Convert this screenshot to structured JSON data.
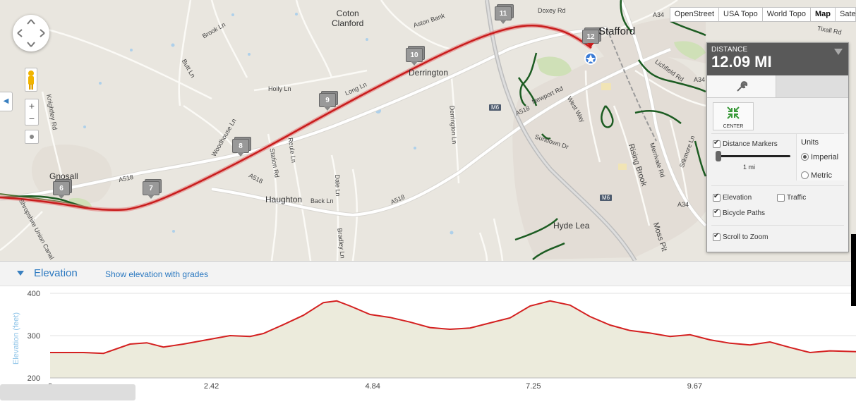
{
  "map": {
    "basemaps": [
      "OpenStreet",
      "USA Topo",
      "World Topo",
      "Map",
      "Satellite"
    ],
    "active_basemap": "Map",
    "places": [
      {
        "name": "Coton Clanford",
        "kind": "town"
      },
      {
        "name": "Derrington",
        "kind": "town"
      },
      {
        "name": "Gnosall",
        "kind": "town"
      },
      {
        "name": "Haughton",
        "kind": "town"
      },
      {
        "name": "Hyde Lea",
        "kind": "town"
      },
      {
        "name": "Stafford",
        "kind": "city"
      }
    ],
    "roads": [
      "Doxey Rd",
      "Aston Bank",
      "Brook Ln",
      "Butt Ln",
      "Holly Ln",
      "Long Ln",
      "Knightley Rd",
      "Woodhouse Ln",
      "Station Rd",
      "Reule Ln",
      "Dale Ln",
      "Back Ln",
      "Bradley Ln",
      "Derrington Ln",
      "Newport Rd",
      "West Way",
      "Sundown Dr",
      "Rising Brook",
      "Merrivale Rd",
      "Moss Pit",
      "Silkmore Ln",
      "Lichfield Rd",
      "Tixall Rd",
      "Shropshire Union Canal",
      "A518",
      "A518",
      "A518",
      "A518",
      "A34",
      "A34",
      "A34"
    ],
    "motorway_labels": [
      "M6",
      "M6"
    ],
    "markers": [
      "6",
      "7",
      "8",
      "9",
      "10",
      "11",
      "12"
    ],
    "start_marker_color": "#cc2222"
  },
  "panel": {
    "distance_label": "DISTANCE",
    "distance_value": "12.09 MI",
    "center_label": "CENTER",
    "distance_markers_label": "Distance Markers",
    "distance_markers_checked": true,
    "marker_interval": "1 mi",
    "units_label": "Units",
    "units_options": [
      "Imperial",
      "Metric"
    ],
    "units_selected": "Imperial",
    "elevation_label": "Elevation",
    "elevation_checked": true,
    "traffic_label": "Traffic",
    "traffic_checked": false,
    "bicycle_label": "Bicycle Paths",
    "bicycle_checked": true,
    "scroll_zoom_label": "Scroll to Zoom",
    "scroll_zoom_checked": true
  },
  "elevation": {
    "title": "Elevation",
    "grades_link": "Show elevation with grades"
  },
  "chart_data": {
    "type": "area",
    "ylabel": "Elevation (feet)",
    "xlabel": "",
    "ylim": [
      200,
      400
    ],
    "xlim": [
      0,
      12.09
    ],
    "yticks": [
      400,
      300,
      200
    ],
    "xticks": [
      "0",
      "2.42",
      "4.84",
      "7.25",
      "9.67"
    ],
    "line_color": "#d42020",
    "fill_color": "#ecebdc",
    "series": [
      {
        "x": [
          0,
          0.5,
          0.8,
          1.2,
          1.45,
          1.7,
          2.0,
          2.35,
          2.7,
          3.0,
          3.2,
          3.5,
          3.8,
          4.1,
          4.3,
          4.5,
          4.8,
          5.1,
          5.4,
          5.7,
          6.0,
          6.3,
          6.6,
          6.9,
          7.2,
          7.5,
          7.8,
          8.1,
          8.4,
          8.7,
          9.0,
          9.3,
          9.6,
          9.9,
          10.2,
          10.5,
          10.8,
          11.1,
          11.4,
          11.7,
          12.09
        ],
        "y": [
          260,
          260,
          258,
          280,
          283,
          273,
          280,
          290,
          300,
          298,
          305,
          326,
          348,
          378,
          382,
          370,
          350,
          343,
          332,
          319,
          315,
          318,
          330,
          342,
          370,
          382,
          372,
          345,
          325,
          312,
          306,
          298,
          302,
          290,
          282,
          278,
          285,
          272,
          260,
          264,
          262
        ]
      }
    ]
  }
}
